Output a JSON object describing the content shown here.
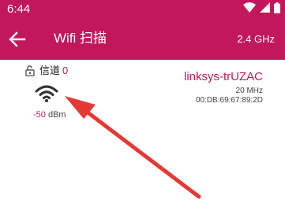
{
  "colors": {
    "bar": "#c2185b",
    "accent": "#c2185b",
    "arrow": "#e53935"
  },
  "status_bar": {
    "time": "6:44",
    "icons": [
      "wifi-icon",
      "cell-signal-icon",
      "battery-icon"
    ]
  },
  "app_bar": {
    "back_icon": "arrow-back-icon",
    "title": "Wifi 扫描",
    "band": "2.4 GHz"
  },
  "network": {
    "lock_icon": "unlocked-icon",
    "channel_label": "信道",
    "channel_value": "0",
    "signal_icon": "wifi-icon",
    "signal_value": "-50",
    "signal_unit": "dBm",
    "ssid": "linksys-trUZAC",
    "channel_width": "20 MHz",
    "bssid": "00:DB:69:67:89:2D"
  },
  "annotation": {
    "icon": "red-arrow-icon"
  }
}
